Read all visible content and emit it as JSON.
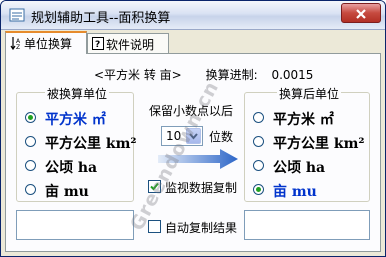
{
  "window": {
    "title": "规划辅助工具--面积换算"
  },
  "tabs": [
    {
      "label": "单位换算",
      "icon": "sort-az-icon"
    },
    {
      "label": "软件说明",
      "icon": "help-icon"
    }
  ],
  "headline": {
    "pair": "<平方米 转 亩>",
    "ratio_label": "换算进制:",
    "ratio_value": "0.0015"
  },
  "source_group": {
    "title": "被换算单位",
    "options": [
      {
        "label": "平方米 ㎡",
        "checked": true
      },
      {
        "label": "平方公里 km²",
        "checked": false
      },
      {
        "label": "公顷 ha",
        "checked": false
      },
      {
        "label": "亩 mu",
        "checked": false
      }
    ]
  },
  "target_group": {
    "title": "换算后单位",
    "options": [
      {
        "label": "平方米 ㎡",
        "checked": false
      },
      {
        "label": "平方公里 km²",
        "checked": false
      },
      {
        "label": "公顷 ha",
        "checked": false
      },
      {
        "label": "亩 mu",
        "checked": true
      }
    ]
  },
  "precision": {
    "label": "保留小数点以后",
    "value": "10",
    "unit": "位数"
  },
  "copy_options": {
    "monitor_label": "监视数据复制",
    "monitor_checked": true,
    "auto_label": "自动复制结果",
    "auto_checked": false
  },
  "inputs": {
    "source_value": "",
    "target_value": ""
  },
  "watermark": "Greendown.cn",
  "colors": {
    "accent": "#e68b2c",
    "selected_text": "#0033cc",
    "radio_dot": "#21a121"
  }
}
